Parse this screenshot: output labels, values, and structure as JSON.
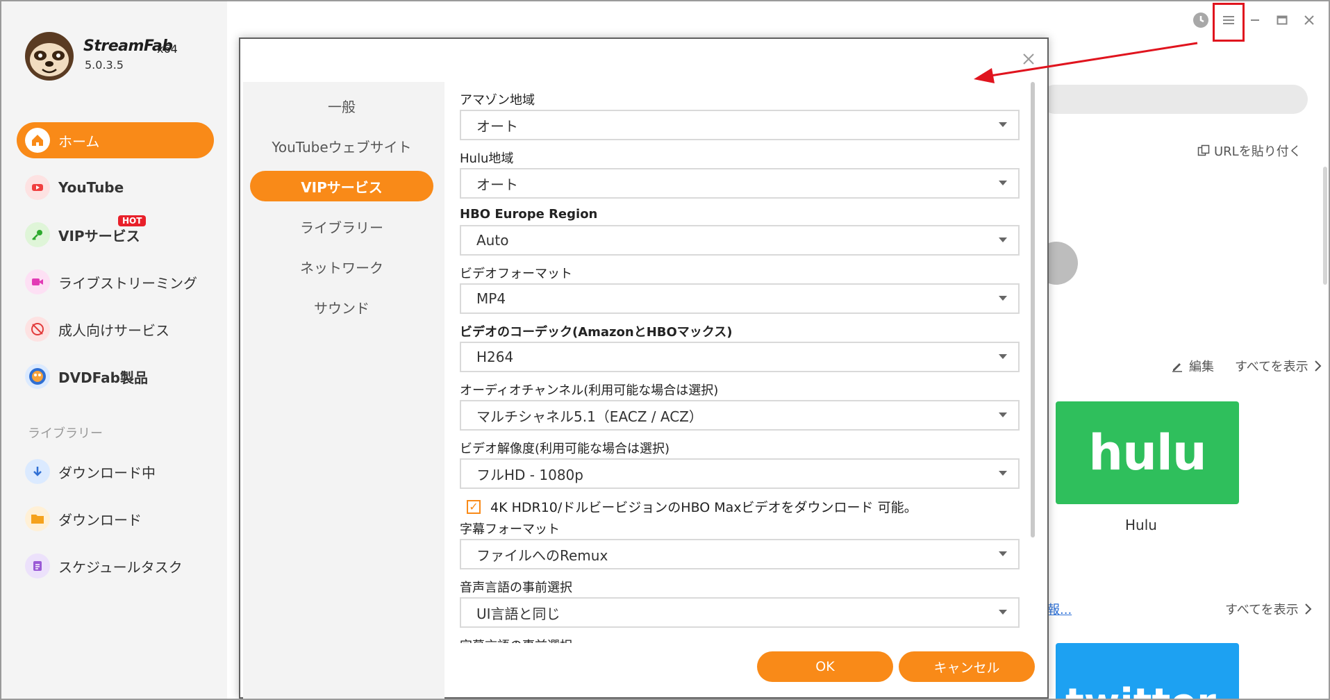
{
  "app": {
    "brand": "StreamFab",
    "arch": "x64",
    "version": "5.0.3.5"
  },
  "sidebar": {
    "items": [
      {
        "label": "ホーム",
        "icon": "home-icon"
      },
      {
        "label": "YouTube",
        "icon": "youtube-icon"
      },
      {
        "label": "VIPサービス",
        "icon": "key-icon",
        "badge": "HOT"
      },
      {
        "label": "ライブストリーミング",
        "icon": "camera-icon"
      },
      {
        "label": "成人向けサービス",
        "icon": "adult-icon"
      },
      {
        "label": "DVDFab製品",
        "icon": "dvdfab-icon"
      }
    ],
    "library_title": "ライブラリー",
    "library_items": [
      {
        "label": "ダウンロード中",
        "icon": "download-arrow-icon"
      },
      {
        "label": "ダウンロード",
        "icon": "folder-icon"
      },
      {
        "label": "スケジュールタスク",
        "icon": "schedule-icon"
      }
    ]
  },
  "background": {
    "url_paste": "URLを貼り付く",
    "edit": "編集",
    "show_all": "すべてを表示",
    "hulu_logo": "hulu",
    "hulu_label": "Hulu",
    "news_link": "報...",
    "show_all_2": "すべてを表示",
    "twitter_logo": "twitter"
  },
  "dialog": {
    "tabs": [
      "一般",
      "YouTubeウェブサイト",
      "VIPサービス",
      "ライブラリー",
      "ネットワーク",
      "サウンド"
    ],
    "active_tab": "VIPサービス",
    "fields": [
      {
        "label": "アマゾン地域",
        "value": "オート"
      },
      {
        "label": "Hulu地域",
        "value": "オート"
      },
      {
        "label": "HBO Europe Region",
        "value": "Auto"
      },
      {
        "label": "ビデオフォーマット",
        "value": "MP4"
      },
      {
        "label": "ビデオのコーデック(AmazonとHBOマックス)",
        "value": "H264"
      },
      {
        "label": "オーディオチャンネル(利用可能な場合は選択)",
        "value": "マルチシャネル5.1（EACZ / ACZ）"
      },
      {
        "label": "ビデオ解像度(利用可能な場合は選択)",
        "value": "フルHD - 1080p"
      }
    ],
    "checkbox_label": "4K HDR10/ドルビービジョンのHBO Maxビデオをダウンロード 可能。",
    "checkbox_checked": true,
    "fields_2": [
      {
        "label": "字幕フォーマット",
        "value": "ファイルへのRemux"
      },
      {
        "label": "音声言語の事前選択",
        "value": "UI言語と同じ"
      }
    ],
    "partial_label": "字幕言語の事前選択",
    "ok": "OK",
    "cancel": "キャンセル"
  },
  "colors": {
    "accent": "#f98a18",
    "annotation": "#e0141e"
  }
}
